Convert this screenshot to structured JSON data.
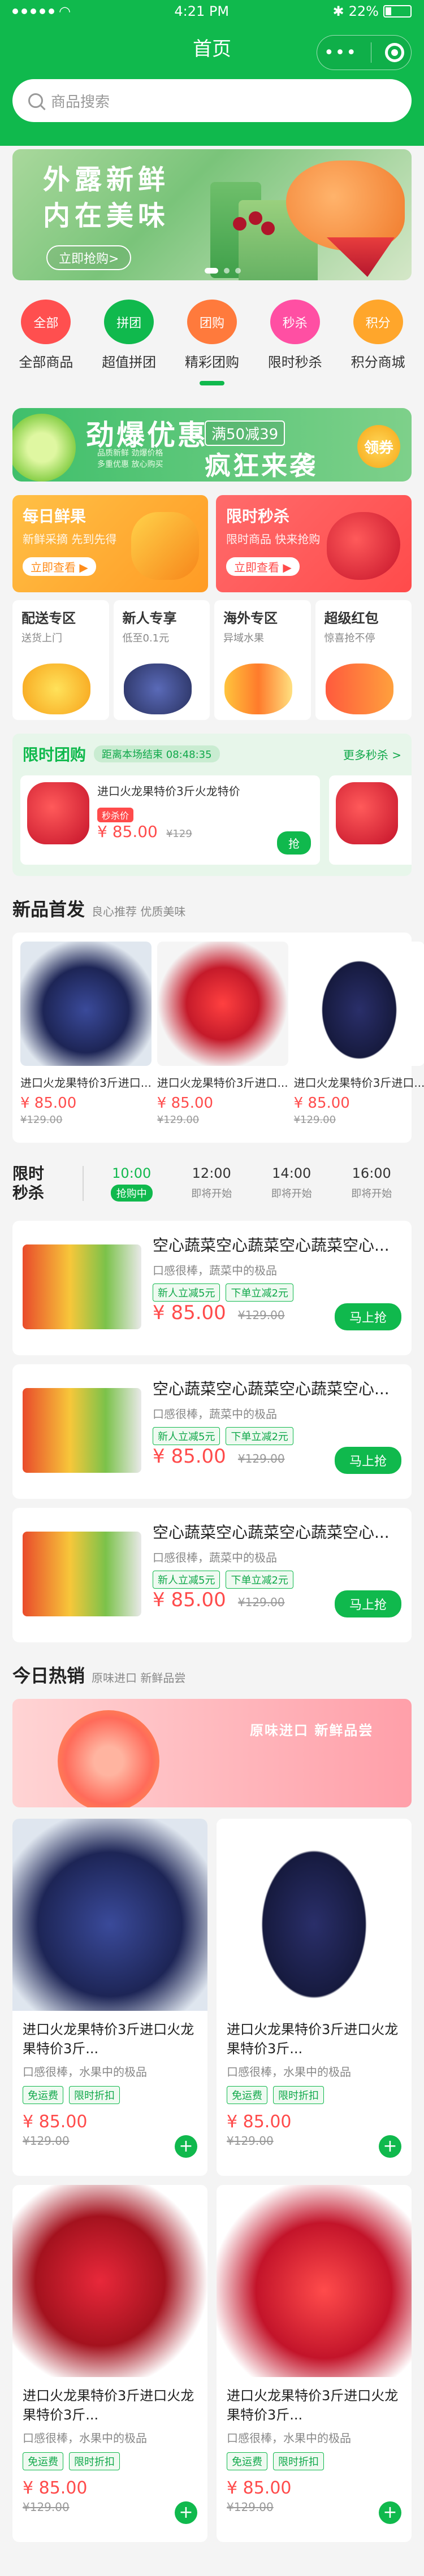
{
  "status": {
    "time": "4:21 PM",
    "battery": "22%"
  },
  "nav": {
    "title": "首页"
  },
  "search": {
    "placeholder": "商品搜索"
  },
  "banner": {
    "title_line1": "外露新鲜",
    "title_line2": "内在美味",
    "cta": "立即抢购>"
  },
  "categories": [
    {
      "icon_text": "全部",
      "label": "全部商品",
      "color": "#ff4f4f"
    },
    {
      "icon_text": "拼团",
      "label": "超值拼团",
      "color": "#10b94d"
    },
    {
      "icon_text": "团购",
      "label": "精彩团购",
      "color": "#ff7a3c"
    },
    {
      "icon_text": "秒杀",
      "label": "限时秒杀",
      "color": "#ff4fa3"
    },
    {
      "icon_text": "积分",
      "label": "积分商城",
      "color": "#ffa62b"
    }
  ],
  "promo": {
    "title1": "劲爆优惠",
    "badge": "满50减39",
    "title2": "疯狂来袭",
    "fine_print": "品质新鲜 劲爆价格\n多重优惠 放心购买",
    "coin": "领券"
  },
  "duo": [
    {
      "title": "每日鲜果",
      "sub": "新鲜采摘 先到先得",
      "cta": "立即查看 ▶"
    },
    {
      "title": "限时秒杀",
      "sub": "限时商品 快来抢购",
      "cta": "立即查看 ▶"
    }
  ],
  "zones": [
    {
      "title": "配送专区",
      "sub": "送货上门"
    },
    {
      "title": "新人专享",
      "sub": "低至0.1元"
    },
    {
      "title": "海外专区",
      "sub": "异域水果"
    },
    {
      "title": "超级红包",
      "sub": "惊喜抢不停"
    }
  ],
  "group": {
    "title": "限时团购",
    "countdown": "距离本场结束 08:48:35",
    "more": "更多秒杀 >",
    "card": {
      "name": "进口火龙果特价3斤火龙特价",
      "tag": "秒杀价",
      "price": "¥ 85.00",
      "old_price": "¥129",
      "cta": "抢"
    }
  },
  "new_products": {
    "title": "新品首发",
    "sub": "良心推荐 优质美味",
    "items": [
      {
        "name": "进口火龙果特价3斤进口...",
        "price": "¥ 85.00",
        "old_price": "¥129.00"
      },
      {
        "name": "进口火龙果特价3斤进口...",
        "price": "¥ 85.00",
        "old_price": "¥129.00"
      },
      {
        "name": "进口火龙果特价3斤进口...",
        "price": "¥ 85.00",
        "old_price": "¥129.00"
      }
    ]
  },
  "flash": {
    "title_line1": "限时",
    "title_line2": "秒杀",
    "slots": [
      {
        "time": "10:00",
        "status": "抢购中"
      },
      {
        "time": "12:00",
        "status": "即将开始"
      },
      {
        "time": "14:00",
        "status": "即将开始"
      },
      {
        "time": "16:00",
        "status": "即将开始"
      }
    ],
    "items": [
      {
        "name": "空心蔬菜空心蔬菜空心蔬菜空心...",
        "desc": "口感很棒，蔬菜中的极品",
        "tag1": "新人立减5元",
        "tag2": "下单立减2元",
        "price": "¥ 85.00",
        "old_price": "¥129.00",
        "cta": "马上抢"
      },
      {
        "name": "空心蔬菜空心蔬菜空心蔬菜空心...",
        "desc": "口感很棒，蔬菜中的极品",
        "tag1": "新人立减5元",
        "tag2": "下单立减2元",
        "price": "¥ 85.00",
        "old_price": "¥129.00",
        "cta": "马上抢"
      },
      {
        "name": "空心蔬菜空心蔬菜空心蔬菜空心...",
        "desc": "口感很棒，蔬菜中的极品",
        "tag1": "新人立减5元",
        "tag2": "下单立减2元",
        "price": "¥ 85.00",
        "old_price": "¥129.00",
        "cta": "马上抢"
      }
    ]
  },
  "hot": {
    "title": "今日热销",
    "sub": "原味进口 新鲜品尝",
    "banner_text": "原味进口 新鲜品尝",
    "items": [
      {
        "name": "进口火龙果特价3斤进口火龙果特价3斤...",
        "desc": "口感很棒，水果中的极品",
        "tag1": "免运费",
        "tag2": "限时折扣",
        "price": "¥ 85.00",
        "old_price": "¥129.00"
      },
      {
        "name": "进口火龙果特价3斤进口火龙果特价3斤...",
        "desc": "口感很棒，水果中的极品",
        "tag1": "免运费",
        "tag2": "限时折扣",
        "price": "¥ 85.00",
        "old_price": "¥129.00"
      },
      {
        "name": "进口火龙果特价3斤进口火龙果特价3斤...",
        "desc": "口感很棒，水果中的极品",
        "tag1": "免运费",
        "tag2": "限时折扣",
        "price": "¥ 85.00",
        "old_price": "¥129.00"
      },
      {
        "name": "进口火龙果特价3斤进口火龙果特价3斤...",
        "desc": "口感很棒，水果中的极品",
        "tag1": "免运费",
        "tag2": "限时折扣",
        "price": "¥ 85.00",
        "old_price": "¥129.00"
      }
    ]
  }
}
